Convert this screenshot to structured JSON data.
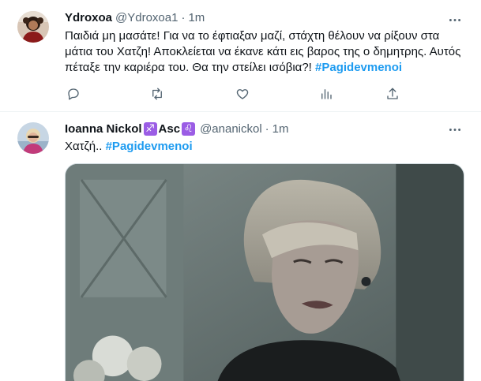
{
  "tweets": [
    {
      "display_name": "Ydroxoa",
      "handle": "@Ydroxoa1",
      "separator": "·",
      "time": "1m",
      "text": "Παιδιά μη μασάτε! Για να το έφτιαξαν μαζί, στάχτη θέλουν να ρίξουν στα μάτια του Χατζη! Αποκλείεται να έκανε κάτι εις βαρος της ο δημητρης. Αυτός πέταξε την καριέρα του. Θα την στείλει ισόβια?!",
      "hashtag": "#Pagidevmenoi",
      "more_icon": "more-horizontal-icon",
      "actions": [
        {
          "icon": "reply-icon"
        },
        {
          "icon": "retweet-icon"
        },
        {
          "icon": "like-icon"
        },
        {
          "icon": "views-icon"
        },
        {
          "icon": "share-icon"
        }
      ]
    },
    {
      "display_name": "Ioanna Nickol",
      "zodiac_sagittarius": "♐",
      "zodiac_label": "Asc",
      "zodiac_leo": "♌",
      "handle": "@ananickol",
      "separator": "·",
      "time": "1m",
      "text": "Χατζή..",
      "hashtag": "#Pagidevmenoi",
      "more_icon": "more-horizontal-icon"
    }
  ],
  "colors": {
    "accent": "#1d9bf0",
    "zodiac_badge": "#9b5de5",
    "secondary_text": "#536471",
    "primary_text": "#0f1419"
  }
}
